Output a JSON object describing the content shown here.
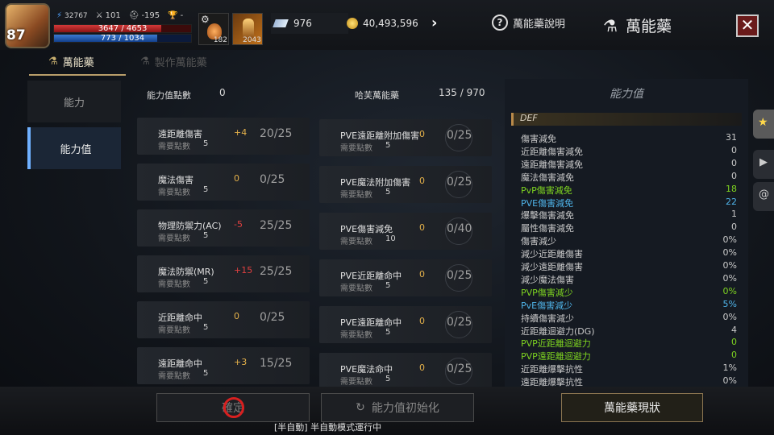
{
  "player": {
    "level": "87",
    "power": "32767",
    "attack": "101",
    "defense": "-195",
    "trophy": "-",
    "hp_text": "3647 / 4653",
    "hp_fill": 0.78,
    "mp_text": "773 / 1034",
    "mp_fill": 0.75
  },
  "items": [
    {
      "count": "182"
    },
    {
      "count": "2043"
    }
  ],
  "currency": {
    "crystal": "976",
    "gold": "40,493,596"
  },
  "header": {
    "help_label": "萬能藥說明",
    "title": "萬能藥",
    "close": "✕"
  },
  "tabs": [
    {
      "label": "萬能藥"
    },
    {
      "label": "製作萬能藥"
    }
  ],
  "use_button": "服用",
  "sidenav": [
    {
      "label": "能力"
    },
    {
      "label": "能力值"
    }
  ],
  "points": {
    "label": "能力值點數",
    "value": "0",
    "elixir_label": "哈芙萬能藥",
    "elixir_value": "135 / 970"
  },
  "req_label": "需要點數",
  "left_cards": [
    {
      "name": "遠距離傷害",
      "req": "5",
      "delta": "+4",
      "delta_color": "#e3b04a",
      "ratio": "20/25"
    },
    {
      "name": "魔法傷害",
      "req": "5",
      "delta": "0",
      "delta_color": "#e3b04a",
      "ratio": "0/25"
    },
    {
      "name": "物理防禦力(AC)",
      "req": "5",
      "delta": "-5",
      "delta_color": "#e04040",
      "ratio": "25/25"
    },
    {
      "name": "魔法防禦(MR)",
      "req": "5",
      "delta": "+15",
      "delta_color": "#e04040",
      "ratio": "25/25"
    },
    {
      "name": "近距離命中",
      "req": "5",
      "delta": "0",
      "delta_color": "#e3b04a",
      "ratio": "0/25"
    },
    {
      "name": "遠距離命中",
      "req": "5",
      "delta": "+3",
      "delta_color": "#e3b04a",
      "ratio": "15/25"
    }
  ],
  "right_cards": [
    {
      "name": "PVE遠距離附加傷害",
      "req": "5",
      "delta": "0",
      "ratio": "0/25"
    },
    {
      "name": "PVE魔法附加傷害",
      "req": "5",
      "delta": "0",
      "ratio": "0/25"
    },
    {
      "name": "PVE傷害減免",
      "req": "10",
      "delta": "0",
      "ratio": "0/40"
    },
    {
      "name": "PVE近距離命中",
      "req": "5",
      "delta": "0",
      "ratio": "0/25"
    },
    {
      "name": "PVE遠距離命中",
      "req": "5",
      "delta": "0",
      "ratio": "0/25"
    },
    {
      "name": "PVE魔法命中",
      "req": "5",
      "delta": "0",
      "ratio": "0/25"
    }
  ],
  "stats_panel": {
    "title": "能力值",
    "section": "DEF",
    "rows": [
      {
        "name": "傷害減免",
        "value": "31",
        "color": "#c9c9c9"
      },
      {
        "name": "近距離傷害減免",
        "value": "0",
        "color": "#c9c9c9"
      },
      {
        "name": "遠距離傷害減免",
        "value": "0",
        "color": "#c9c9c9"
      },
      {
        "name": "魔法傷害減免",
        "value": "0",
        "color": "#c9c9c9"
      },
      {
        "name": "PvP傷害減免",
        "value": "18",
        "color": "#7ed321"
      },
      {
        "name": "PVE傷害減免",
        "value": "22",
        "color": "#4fb3e8"
      },
      {
        "name": "爆擊傷害減免",
        "value": "1",
        "color": "#c9c9c9"
      },
      {
        "name": "屬性傷害減免",
        "value": "0",
        "color": "#c9c9c9"
      },
      {
        "name": "傷害減少",
        "value": "0%",
        "color": "#c9c9c9"
      },
      {
        "name": "減少近距離傷害",
        "value": "0%",
        "color": "#c9c9c9"
      },
      {
        "name": "減少遠距離傷害",
        "value": "0%",
        "color": "#c9c9c9"
      },
      {
        "name": "減少魔法傷害",
        "value": "0%",
        "color": "#c9c9c9"
      },
      {
        "name": "PVP傷害減少",
        "value": "0%",
        "color": "#7ed321"
      },
      {
        "name": "PvE傷害減少",
        "value": "5%",
        "color": "#4fb3e8"
      },
      {
        "name": "持續傷害減少",
        "value": "0%",
        "color": "#c9c9c9"
      },
      {
        "name": "近距離迴避力(DG)",
        "value": "4",
        "color": "#c9c9c9"
      },
      {
        "name": "PVP近距離迴避力",
        "value": "0",
        "color": "#7ed321"
      },
      {
        "name": "PVP遠距離迴避力",
        "value": "0",
        "color": "#7ed321"
      },
      {
        "name": "近距離爆擊抗性",
        "value": "1%",
        "color": "#c9c9c9"
      },
      {
        "name": "遠距離爆擊抗性",
        "value": "0%",
        "color": "#c9c9c9"
      }
    ]
  },
  "footer": {
    "confirm": "確定",
    "reset": "能力值初始化",
    "status_btn": "萬能藥現狀",
    "auto_status": "[半自動] 半自動模式運行中"
  }
}
